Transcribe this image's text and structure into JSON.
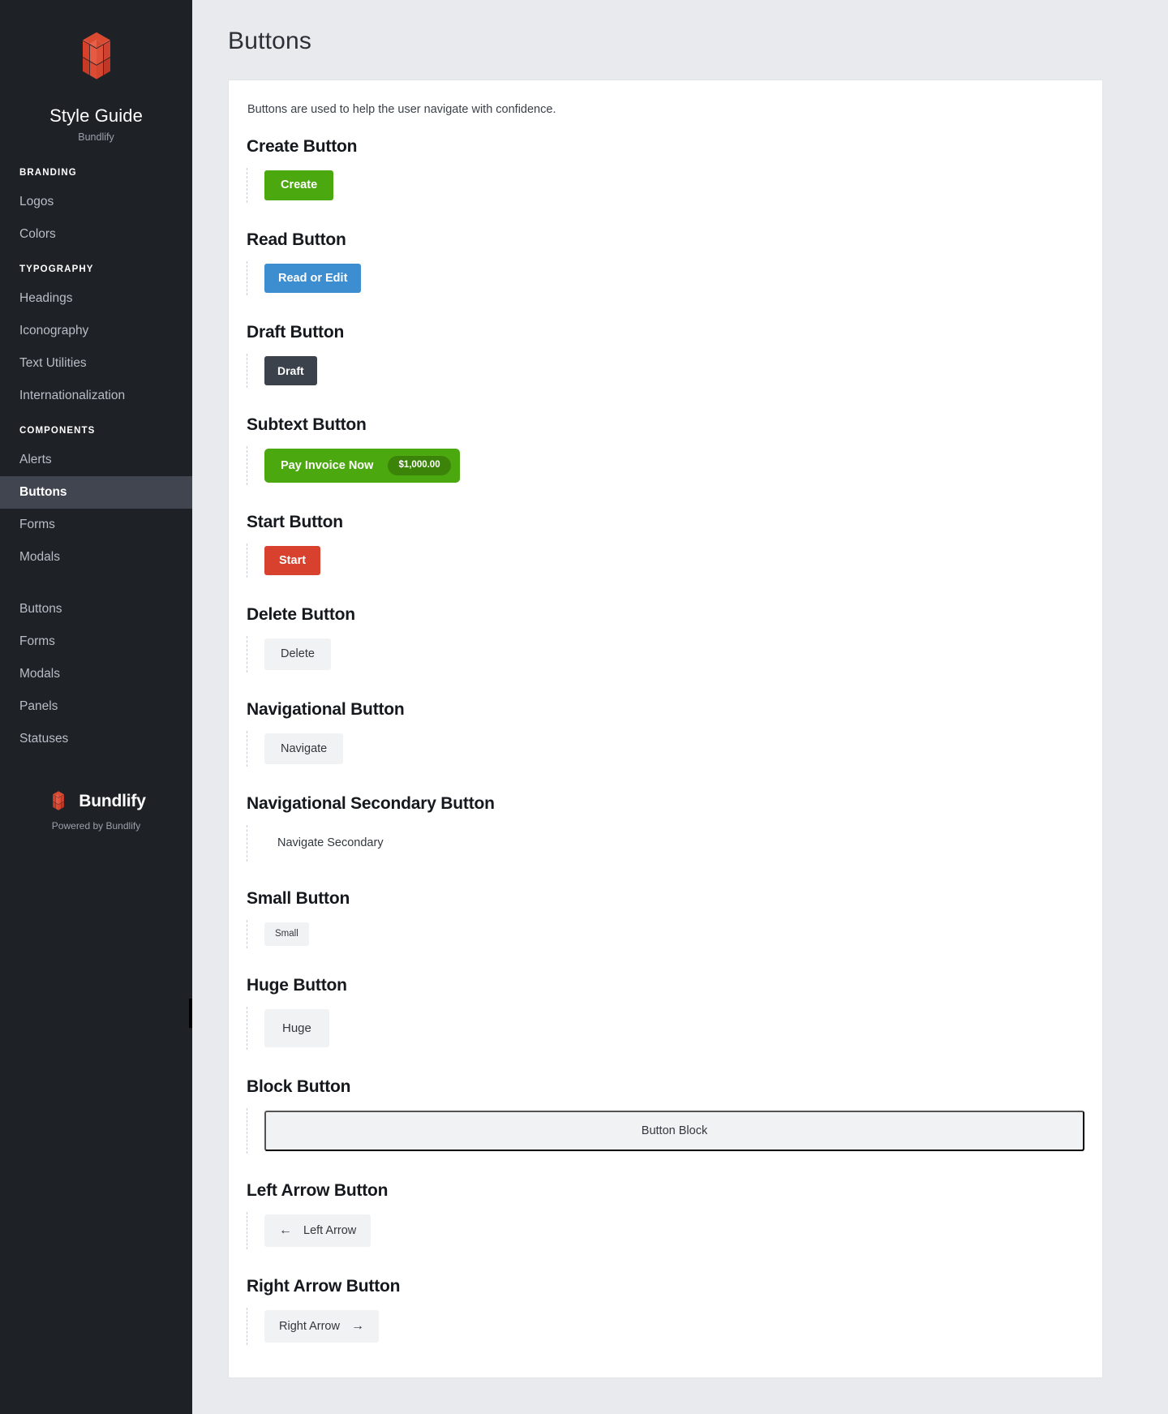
{
  "sidebar": {
    "logo_icon": "cube-logo-icon",
    "title": "Style Guide",
    "subtitle": "Bundlify",
    "groups": [
      {
        "header": "BRANDING",
        "items": [
          {
            "label": "Logos",
            "active": false
          },
          {
            "label": "Colors",
            "active": false
          }
        ]
      },
      {
        "header": "TYPOGRAPHY",
        "items": [
          {
            "label": "Headings",
            "active": false
          },
          {
            "label": "Iconography",
            "active": false
          },
          {
            "label": "Text Utilities",
            "active": false
          },
          {
            "label": "Internationalization",
            "active": false
          }
        ]
      },
      {
        "header": "COMPONENTS",
        "items": [
          {
            "label": "Alerts",
            "active": false
          },
          {
            "label": "Buttons",
            "active": true
          },
          {
            "label": "Forms",
            "active": false
          },
          {
            "label": "Modals",
            "active": false
          }
        ]
      },
      {
        "header": "",
        "items": [
          {
            "label": "Buttons",
            "active": false
          },
          {
            "label": "Forms",
            "active": false
          },
          {
            "label": "Modals",
            "active": false
          },
          {
            "label": "Panels",
            "active": false
          },
          {
            "label": "Statuses",
            "active": false
          }
        ]
      }
    ],
    "footer": {
      "brand_name": "Bundlify",
      "powered_by": "Powered by Bundlify",
      "logo_icon": "cube-logo-icon"
    }
  },
  "main": {
    "page_title": "Buttons",
    "intro": "Buttons are used to help the user navigate with confidence.",
    "sections": [
      {
        "title": "Create Button",
        "button_label": "Create"
      },
      {
        "title": "Read Button",
        "button_label": "Read or Edit"
      },
      {
        "title": "Draft Button",
        "button_label": "Draft"
      },
      {
        "title": "Subtext Button",
        "button_label": "Pay Invoice Now",
        "badge": "$1,000.00"
      },
      {
        "title": "Start Button",
        "button_label": "Start"
      },
      {
        "title": "Delete Button",
        "button_label": "Delete"
      },
      {
        "title": "Navigational Button",
        "button_label": "Navigate"
      },
      {
        "title": "Navigational Secondary Button",
        "button_label": "Navigate Secondary"
      },
      {
        "title": "Small Button",
        "button_label": "Small"
      },
      {
        "title": "Huge Button",
        "button_label": "Huge"
      },
      {
        "title": "Block Button",
        "button_label": "Button Block"
      },
      {
        "title": "Left Arrow Button",
        "button_label": "Left Arrow",
        "icon": "arrow-left-icon",
        "glyph": "←"
      },
      {
        "title": "Right Arrow Button",
        "button_label": "Right Arrow",
        "icon": "arrow-right-icon",
        "glyph": "→"
      }
    ]
  },
  "colors": {
    "sidebar_bg": "#1e2126",
    "sidebar_active": "#41454f",
    "brand_red": "#dc4a33",
    "green": "#4ca80f",
    "green_dark": "#3c8409",
    "blue": "#3d8dd1",
    "slate": "#3b424b",
    "red": "#d8412d",
    "muted": "#f1f2f4",
    "page_bg": "#e9eaee"
  }
}
